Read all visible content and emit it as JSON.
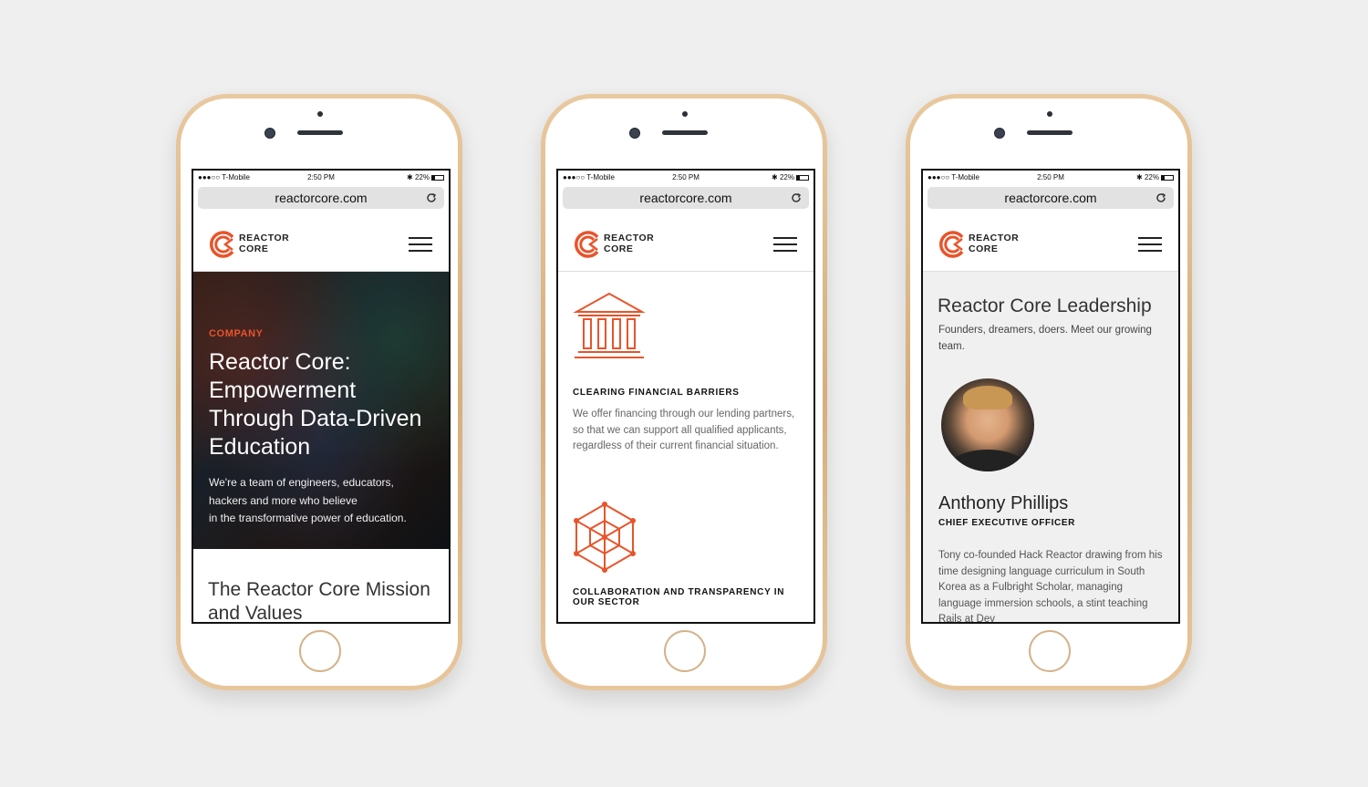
{
  "colors": {
    "accent": "#e8542b",
    "page_bg": "#efefef",
    "phone_gold": "#d6ae7d"
  },
  "status": {
    "carrier": "●●●○○ T-Mobile",
    "time": "2:50 PM",
    "battery": "22%"
  },
  "browser": {
    "url": "reactorcore.com"
  },
  "brand": {
    "line1": "REACTOR",
    "line2": "CORE"
  },
  "phone1": {
    "eyebrow": "COMPANY",
    "title": "Reactor Core: Empowerment Through Data-Driven Education",
    "body_lines": [
      "We're a team of engineers, educators,",
      "hackers and more who believe",
      "in the transformative power of education."
    ],
    "mission": "The Reactor Core Mission and Values"
  },
  "phone2": {
    "features": [
      {
        "icon": "bank-columns-icon",
        "title": "CLEARING FINANCIAL BARRIERS",
        "body": "We offer financing through our lending partners, so that we can support all qualified applicants, regardless of their current financial situation."
      },
      {
        "icon": "hexagon-network-icon",
        "title": "COLLABORATION AND TRANSPARENCY IN OUR SECTOR",
        "body": ""
      }
    ]
  },
  "phone3": {
    "title": "Reactor Core Leadership",
    "subtitle": "Founders, dreamers, doers. Meet our growing team.",
    "leader": {
      "name": "Anthony Phillips",
      "role": "CHIEF EXECUTIVE OFFICER",
      "bio": "Tony co-founded Hack Reactor drawing from his time designing language curriculum in South Korea as a Fulbright Scholar, managing language immersion schools, a stint teaching Rails at Dev"
    }
  }
}
